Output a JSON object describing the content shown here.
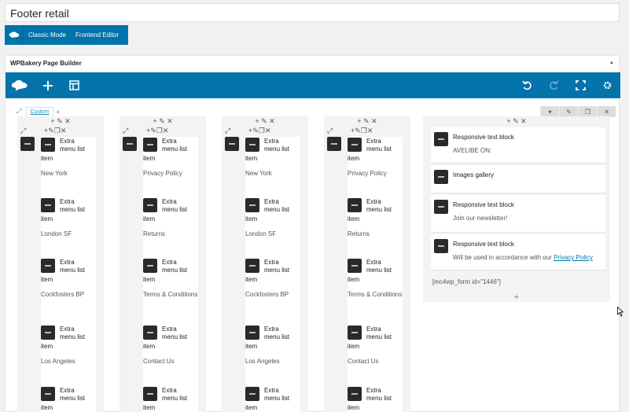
{
  "post_title": "Footer retail",
  "mode_bar": {
    "classic": "Classic Mode",
    "frontend": "Frontend Editor"
  },
  "panel": {
    "title": "WPBakery Page Builder"
  },
  "row": {
    "tab": "Custom"
  },
  "columns": [
    {
      "items": [
        {
          "title": "Extra menu list",
          "suffix": "item",
          "value": "New York"
        },
        {
          "title": "Extra menu list",
          "suffix": "item",
          "value": "London SF"
        },
        {
          "title": "Extra menu list",
          "suffix": "item",
          "value": "Cockfosters BP"
        },
        {
          "title": "Extra menu list",
          "suffix": "item",
          "value": "Los Angeles"
        },
        {
          "title": "Extra menu list",
          "suffix": "item",
          "value": ""
        }
      ]
    },
    {
      "items": [
        {
          "title": "Extra menu list",
          "suffix": "item",
          "value": "Privacy Policy"
        },
        {
          "title": "Extra menu list",
          "suffix": "item",
          "value": "Returns"
        },
        {
          "title": "Extra menu list",
          "suffix": "item",
          "value": "Terms & Conditions"
        },
        {
          "title": "Extra menu list",
          "suffix": "item",
          "value": "Contact Us"
        },
        {
          "title": "Extra menu list",
          "suffix": "item",
          "value": ""
        }
      ]
    },
    {
      "items": [
        {
          "title": "Extra menu list",
          "suffix": "item",
          "value": "New York"
        },
        {
          "title": "Extra menu list",
          "suffix": "item",
          "value": "London SF"
        },
        {
          "title": "Extra menu list",
          "suffix": "item",
          "value": "Cockfosters BP"
        },
        {
          "title": "Extra menu list",
          "suffix": "item",
          "value": "Los Angeles"
        },
        {
          "title": "Extra menu list",
          "suffix": "item",
          "value": ""
        }
      ]
    },
    {
      "items": [
        {
          "title": "Extra menu list",
          "suffix": "item",
          "value": "Privacy Policy"
        },
        {
          "title": "Extra menu list",
          "suffix": "item",
          "value": "Returns"
        },
        {
          "title": "Extra menu list",
          "suffix": "item",
          "value": "Terms & Conditions"
        },
        {
          "title": "Extra menu list",
          "suffix": "item",
          "value": "Contact Us"
        },
        {
          "title": "Extra menu list",
          "suffix": "item",
          "value": ""
        }
      ]
    }
  ],
  "right_column": {
    "blocks": [
      {
        "title": "Responsive text block",
        "desc": "AVELIBE ON:"
      },
      {
        "title": "Images gallery",
        "desc": ""
      },
      {
        "title": "Responsive text block",
        "desc": "Join our newsletter!"
      },
      {
        "title": "Responsive text block",
        "desc": "Will be used in accordance with our",
        "link": "Privacy Policy"
      }
    ],
    "shortcode": "[mc4wp_form id=\"1446\"]"
  },
  "colors": {
    "toolbar": "#0473aa",
    "mode_bar": "#0073aa",
    "link": "#0073aa"
  }
}
